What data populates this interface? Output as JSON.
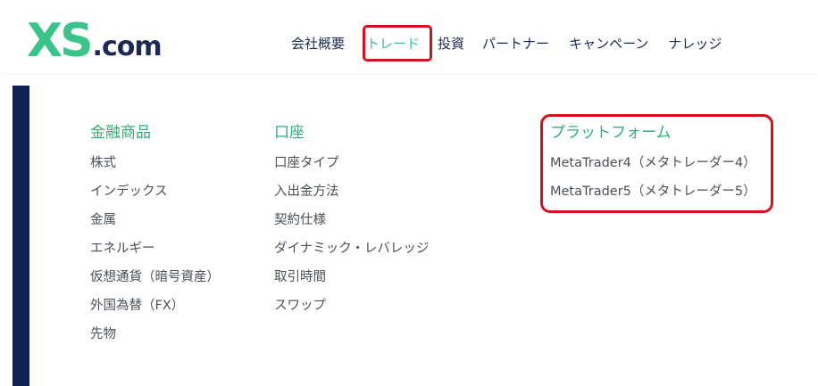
{
  "logo": {
    "primary": "XS",
    "suffix": ".com"
  },
  "nav": {
    "items": [
      {
        "label": "会社概要"
      },
      {
        "label": "トレード"
      },
      {
        "label": "投資"
      },
      {
        "label": "パートナー"
      },
      {
        "label": "キャンペーン"
      },
      {
        "label": "ナレッジ"
      }
    ]
  },
  "menu": {
    "instruments": {
      "title": "金融商品",
      "links": [
        "株式",
        "インデックス",
        "金属",
        "エネルギー",
        "仮想通貨（暗号資産）",
        "外国為替（FX）",
        "先物"
      ]
    },
    "account": {
      "title": "口座",
      "links": [
        "口座タイプ",
        "入出金方法",
        "契約仕様",
        "ダイナミック・レバレッジ",
        "取引時間",
        "スワップ"
      ]
    },
    "platform": {
      "title": "プラットフォーム",
      "links": [
        "MetaTrader4（メタトレーダー4）",
        "MetaTrader5（メタトレーダー5）"
      ]
    }
  },
  "colors": {
    "brand_green": "#3ac489",
    "brand_navy": "#1b2a55",
    "highlight_red": "#d3121e"
  }
}
